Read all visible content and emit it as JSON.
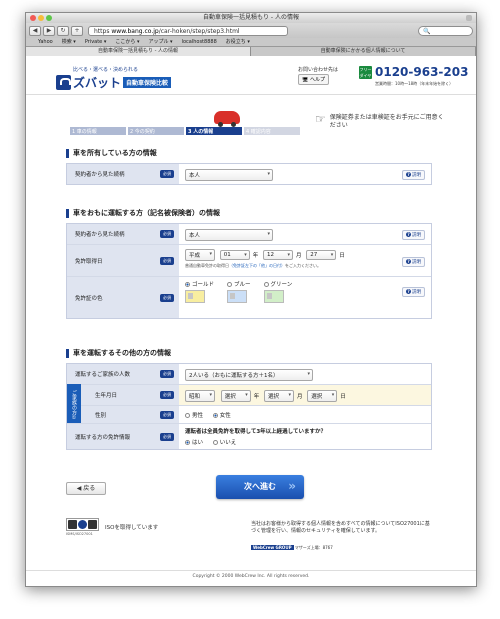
{
  "browser": {
    "title": "自動車保険一括見積もり - 人の情報",
    "url_scheme": "https",
    "url_host": "www.bang.co.jp",
    "url_path": "/car-hoken/step/step3.html",
    "bookmarks": [
      "Yahoo",
      "検索 ▾",
      "Private ▾",
      "ここから ▾",
      "アップル ▾",
      "localhost8888",
      "お役立ち ▾"
    ],
    "tabs": [
      "自動車保険一括見積もり - 人の情報",
      "自動車保険にかかる個人情報について"
    ]
  },
  "header": {
    "logo_tagline": "比べる・選べる・決められる",
    "logo_name": "ズバット",
    "logo_sub": "自動車保険比較",
    "contact_label": "お問い合わせ先は",
    "help_label": "ヘルプ",
    "freedial_icon": "フリーダイヤル",
    "phone": "0120-963-203",
    "hours": "営業時間：10時～18時（年末年始を除く）"
  },
  "progress": {
    "steps": [
      "1 車の情報",
      "2 今の契約",
      "3 人の情報",
      "4 確認内容"
    ],
    "current_step": 3,
    "note": "保険証券または車検証をお手元にご用意ください"
  },
  "owner_section": {
    "title": "車を所有している方の情報",
    "rows": [
      {
        "label": "契約者から見た続柄",
        "required": "必須",
        "value": "本人",
        "help": "説明"
      }
    ]
  },
  "driver_section": {
    "title": "車をおもに運転する方（記名被保険者）の情報",
    "relation_label": "契約者から見た続柄",
    "relation_value": "本人",
    "license_date_label": "免許取得日",
    "era": "平成",
    "year": "01",
    "year_unit": "年",
    "month": "12",
    "month_unit": "月",
    "day": "27",
    "day_unit": "日",
    "license_hint_pre": "普通自動車免許の取得日",
    "license_hint_link": "（免許証左下の「他」の日付）",
    "license_hint_post": "をご入力ください。",
    "color_label": "免許証の色",
    "colors": [
      "ゴールド",
      "ブルー",
      "グリーン"
    ],
    "selected_color": "ゴールド",
    "required": "必須",
    "help": "説明"
  },
  "others_section": {
    "title": "車を運転するその他の方の情報",
    "family_label": "運転するご家族の人数",
    "family_value": "2人いる（おもに運転する方＋1名）",
    "side_label": "ご家族の方①",
    "birth_label": "生年月日",
    "birth_era": "昭和",
    "birth_year": "選択",
    "birth_month": "選択",
    "birth_day": "選択",
    "year_unit": "年",
    "month_unit": "月",
    "day_unit": "日",
    "gender_label": "性別",
    "gender_options": [
      "男性",
      "女性"
    ],
    "gender_selected": "女性",
    "license_label": "運転する方の免許情報",
    "license_question": "運転者は全員免許を取得して3年以上経過していますか？",
    "license_options": [
      "はい",
      "いいえ"
    ],
    "license_selected": "はい",
    "required": "必須",
    "help": "説明"
  },
  "buttons": {
    "back": "◀ 戻る",
    "next": "次へ進む"
  },
  "footer": {
    "iso_label": "ISOを取得しています",
    "iso_code": "ISMS/ISO27001",
    "text": "当社はお客様から取得する個人情報を含めすべての情報についてISO27001に基づく管理を行い、情報のセキュリティを確保しています。",
    "group_badge": "WebCrew GROUP",
    "group_text": "マザーズ上場：8767",
    "copyright": "Copyright © 2000 WebCrew Inc. All rights reserved."
  }
}
